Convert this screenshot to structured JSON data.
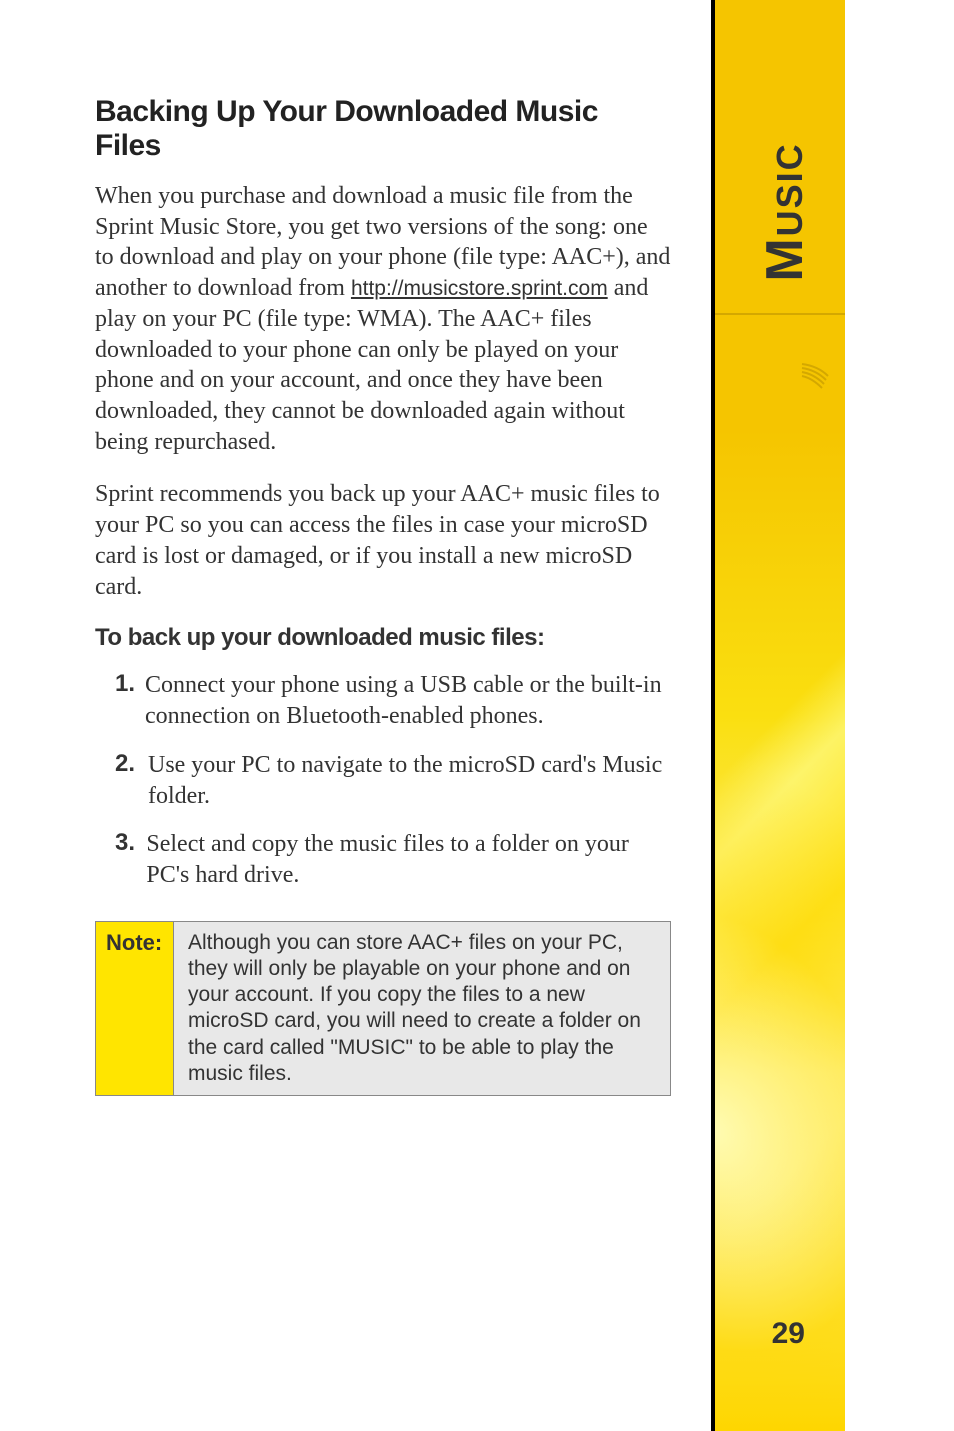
{
  "sideTab": "Music",
  "pageNumber": "29",
  "heading": "Backing Up Your Downloaded Music Files",
  "para1_a": "When you purchase and download a music file from the Sprint Music Store, you get two versions of the song: one to download and play on your phone (file type: AAC+), and another to download from ",
  "link1": "http://musicstore.sprint.com",
  "para1_b": " and play on your PC (file type: WMA). The AAC+ files downloaded to your phone can only be played on your phone and on your account, and once they have been downloaded, they cannot be downloaded again without being repurchased.",
  "para2": "Sprint recommends you back up your AAC+ music files to your PC so you can access the files in case your microSD card is lost or damaged, or if you install a new microSD card.",
  "subheading": "To back up your downloaded music files:",
  "steps": [
    {
      "num": "1.",
      "text": "Connect your phone using a USB cable or the built-in connection on Bluetooth-enabled phones."
    },
    {
      "num": "2.",
      "text": "Use your PC to navigate to the microSD card's Music folder."
    },
    {
      "num": "3.",
      "text": "Select and copy the music files to a folder on your PC's hard drive."
    }
  ],
  "noteLabel": "Note:",
  "noteText": "Although you can store AAC+ files on your PC, they will only be playable on your phone and on your account. If you copy the files to a new microSD card, you will need to create a folder on the card called \"MUSIC\" to be able to play the music files."
}
